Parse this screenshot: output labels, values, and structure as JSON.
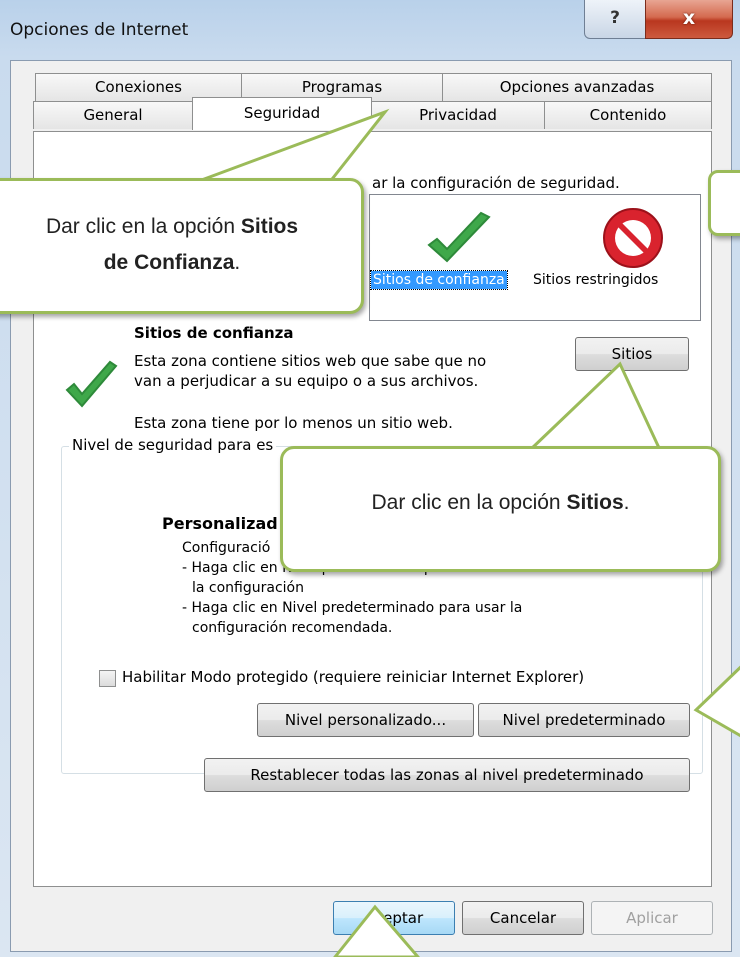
{
  "window": {
    "title": "Opciones de Internet",
    "help_glyph": "?",
    "close_glyph": "x"
  },
  "tabs": {
    "row1": [
      "Conexiones",
      "Programas",
      "Opciones avanzadas"
    ],
    "row2": [
      "General",
      "Seguridad",
      "Privacidad",
      "Contenido"
    ],
    "active": "Seguridad"
  },
  "security": {
    "intro_visible_end": "ar la configuración de seguridad.",
    "zones": {
      "trusted_label": "Sitios de confianza",
      "restricted_label": "Sitios restringidos"
    },
    "zone_title": "Sitios de confianza",
    "zone_desc_line1": "Esta zona contiene sitios web que sabe que no",
    "zone_desc_line2": "van a perjudicar a su equipo o a sus archivos.",
    "zone_note": "Esta zona tiene por lo menos un sitio web.",
    "sites_button": "Sitios",
    "level_group_label": "Nivel de seguridad para es",
    "custom_title": "Personalizad",
    "custom_line1": "Configuració",
    "custom_line2": "- Haga clic en Nivel personalizado para cambiar",
    "custom_line3": "la configuración",
    "custom_line4": "- Haga clic en Nivel predeterminado para usar la",
    "custom_line5": "configuración recomendada.",
    "protected_mode_label": "Habilitar Modo protegido (requiere reiniciar Internet Explorer)",
    "protected_mode_checked": false,
    "custom_level_button": "Nivel personalizado...",
    "default_level_button": "Nivel predeterminado",
    "reset_all_button": "Restablecer todas las zonas al nivel predeterminado"
  },
  "footer": {
    "ok": "Aceptar",
    "cancel": "Cancelar",
    "apply": "Aplicar"
  },
  "callouts": {
    "c1_text_before": "Dar clic  en la opción ",
    "c1_bold_1": "Sitios",
    "c1_bold_2": "de Confianza",
    "c1_after": ".",
    "c2_text_before": "Dar clic en la opción ",
    "c2_bold": "Sitios",
    "c2_after": "."
  },
  "colors": {
    "callout_border": "#9bbb59",
    "selection": "#3399ff",
    "check_green": "#3fa84a",
    "no_red": "#d9232e"
  }
}
